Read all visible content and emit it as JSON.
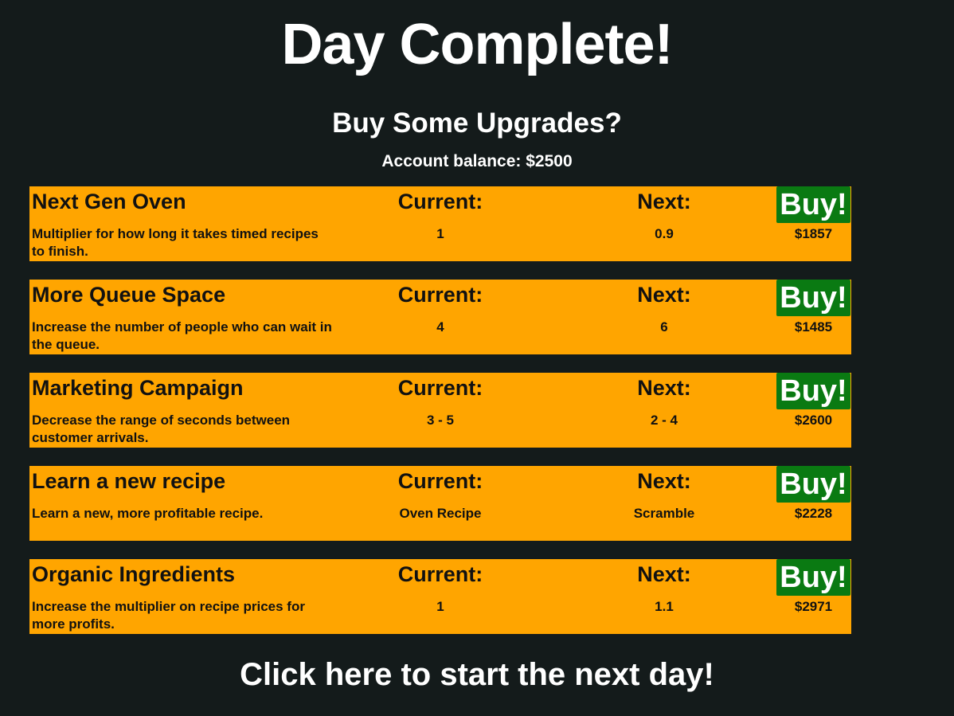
{
  "header": {
    "title": "Day Complete!",
    "subtitle": "Buy Some Upgrades?",
    "balance_label": "Account balance:",
    "balance_value": "$2500"
  },
  "labels": {
    "current": "Current:",
    "next": "Next:",
    "buy": "Buy!"
  },
  "upgrades": [
    {
      "name": "Next Gen Oven",
      "description": "Multiplier for how long it takes timed recipes to finish.",
      "current": "1",
      "next": "0.9",
      "price": "$1857"
    },
    {
      "name": "More Queue Space",
      "description": "Increase the number of people who can wait in the queue.",
      "current": "4",
      "next": "6",
      "price": "$1485"
    },
    {
      "name": "Marketing Campaign",
      "description": "Decrease the range of seconds between customer arrivals.",
      "current": "3 - 5",
      "next": "2 - 4",
      "price": "$2600"
    },
    {
      "name": "Learn a new recipe",
      "description": "Learn a new, more profitable recipe.",
      "current": "Oven Recipe",
      "next": "Scramble",
      "price": "$2228"
    },
    {
      "name": "Organic Ingredients",
      "description": "Increase the multiplier on recipe prices for more profits.",
      "current": "1",
      "next": "1.1",
      "price": "$2971"
    }
  ],
  "footer": {
    "next_day": "Click here to start the next day!"
  },
  "colors": {
    "background": "#141b1b",
    "panel": "#ffa500",
    "buy_button": "#0a7a12",
    "text_light": "#ffffff",
    "text_dark": "#111111"
  }
}
